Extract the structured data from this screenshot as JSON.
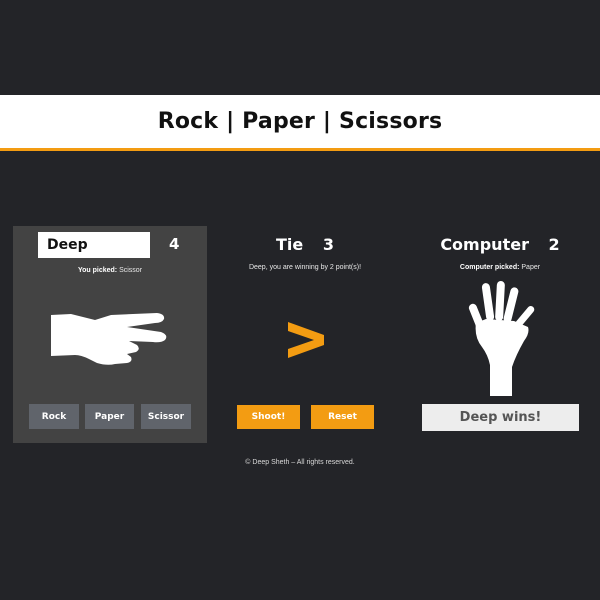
{
  "header": {
    "title": "Rock | Paper | Scissors"
  },
  "player": {
    "name": "Deep",
    "score": "4",
    "picked_label": "You picked:",
    "picked_value": "Scissor",
    "hand_icon": "scissors-hand-icon",
    "buttons": {
      "rock": "Rock",
      "paper": "Paper",
      "scissor": "Scissor"
    }
  },
  "middle": {
    "tie_label": "Tie",
    "tie_score": "3",
    "status": "Deep, you are winning by 2 point(s)!",
    "versus_icon": "greater-than-icon",
    "buttons": {
      "shoot": "Shoot!",
      "reset": "Reset"
    }
  },
  "computer": {
    "label": "Computer",
    "score": "2",
    "picked_label": "Computer picked:",
    "picked_value": "Paper",
    "hand_icon": "paper-hand-icon",
    "result": "Deep wins!"
  },
  "footer": {
    "text": "© Deep Sheth – All rights reserved."
  },
  "colors": {
    "background": "#232428",
    "panel": "#434343",
    "accent": "#f39c12",
    "choice_button": "#60646b",
    "result_box": "#ededed"
  }
}
